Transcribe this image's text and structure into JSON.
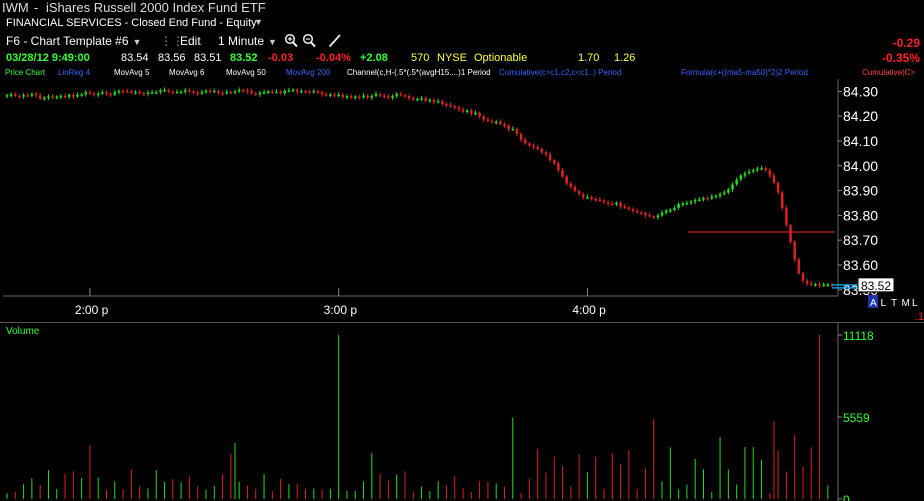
{
  "window": {
    "symbol": "IWM",
    "separator": "-",
    "description": "iShares Russell 2000 Index Fund ETF",
    "sector_line": "FINANCIAL SERVICES - Closed End Fund - Equity"
  },
  "toolbar": {
    "template_label": "F6 - Chart Template #6",
    "edit_label": "Edit",
    "interval_label": "1 Minute",
    "zoom_in_icon": "zoom-in-icon",
    "zoom_out_icon": "zoom-out-icon",
    "draw_icon": "pencil-icon"
  },
  "quote": {
    "datetime": "03/28/12 9:49:00",
    "open": "83.54",
    "high": "83.56",
    "low": "83.51",
    "close": "83.52",
    "change": "-0.03",
    "change_pct": "-0.04%",
    "tick": "+2.08",
    "volume": "570",
    "exchange": "NYSE",
    "optionable": "Optionable",
    "bid_size": "1.70",
    "ask_size": "1.26",
    "day_change": "-0.29",
    "day_change_pct": "-0.35%"
  },
  "studies": {
    "price_chart": "Price Chart",
    "linreg": "LinReg 4",
    "movavg1": "MovAvg 5",
    "movavg2": "MovAvg 6",
    "movavg50": "MovAvg 50",
    "movavg200": "MovAvg 200",
    "channel": "Channel(c,H-(.5*(.5*(avgH15....)1 Period",
    "cumulative1": "Cumulative(c>c1,c2,c<c1..) Period",
    "formula": "Formula(c+((ma5-ma50)*2)2 Period",
    "cumulative2": "Cumulative(C>"
  },
  "colors": {
    "up": "#22dd22",
    "down": "#dd2222",
    "axis_text": "#ffffff",
    "quote_green": "#33ff33",
    "quote_red": "#ff2020",
    "study_blue": "#3366ff",
    "hline": "#cc2222",
    "last_marker": "#00bbff"
  },
  "price_panel": {
    "y_ticks": [
      "84.30",
      "84.20",
      "84.10",
      "84.00",
      "83.90",
      "83.80",
      "83.70",
      "83.60",
      "83.50"
    ],
    "x_ticks": [
      "2:00 p",
      "3:00 p",
      "4:00 p"
    ],
    "last_price_label": "83.52",
    "axis_flags": [
      "A",
      "L",
      "T",
      "M",
      "L"
    ],
    "corner_label": ".1",
    "support_line": 83.733
  },
  "volume_panel": {
    "label": "Volume",
    "y_ticks": [
      "11118",
      "5559",
      "0"
    ]
  },
  "chart_data": {
    "type": "candlestick",
    "x": "1-minute bars, approx. 13:39 to 16:00",
    "y_axis_ticks": [
      84.3,
      84.2,
      84.1,
      84.0,
      83.9,
      83.8,
      83.7,
      83.6,
      83.5
    ],
    "ylim": [
      83.475,
      84.35
    ],
    "x_tick_labels": [
      "2:00 p",
      "3:00 p",
      "4:00 p"
    ],
    "close": [
      84.285,
      84.288,
      84.282,
      84.28,
      84.285,
      84.283,
      84.29,
      84.284,
      84.27,
      84.275,
      84.28,
      84.276,
      84.279,
      84.282,
      84.278,
      84.286,
      84.279,
      84.286,
      84.289,
      84.297,
      84.292,
      84.286,
      84.291,
      84.297,
      84.29,
      84.287,
      84.296,
      84.302,
      84.301,
      84.3,
      84.297,
      84.297,
      84.293,
      84.29,
      84.296,
      84.296,
      84.298,
      84.304,
      84.306,
      84.299,
      84.297,
      84.298,
      84.299,
      84.305,
      84.3,
      84.295,
      84.291,
      84.297,
      84.303,
      84.301,
      84.302,
      84.294,
      84.292,
      84.298,
      84.297,
      84.3,
      84.306,
      84.304,
      84.301,
      84.292,
      84.288,
      84.294,
      84.297,
      84.3,
      84.299,
      84.299,
      84.293,
      84.302,
      84.305,
      84.307,
      84.299,
      84.301,
      84.3,
      84.298,
      84.301,
      84.297,
      84.289,
      84.284,
      84.288,
      84.284,
      84.287,
      84.277,
      84.281,
      84.274,
      84.279,
      84.276,
      84.283,
      84.275,
      84.282,
      84.29,
      84.284,
      84.28,
      84.274,
      84.282,
      84.29,
      84.285,
      84.281,
      84.273,
      84.268,
      84.27,
      84.273,
      84.262,
      84.266,
      84.257,
      84.261,
      84.249,
      84.246,
      84.24,
      84.236,
      84.227,
      84.218,
      84.223,
      84.21,
      84.213,
      84.199,
      84.187,
      84.182,
      84.176,
      84.178,
      84.169,
      84.162,
      84.147,
      84.149,
      84.128,
      84.105,
      84.09,
      84.082,
      84.075,
      84.068,
      84.054,
      84.046,
      84.022,
      84.01,
      83.982,
      83.957,
      83.928,
      83.915,
      83.898,
      83.885,
      83.872,
      83.874,
      83.866,
      83.864,
      83.86,
      83.853,
      83.847,
      83.845,
      83.851,
      83.836,
      83.832,
      83.825,
      83.818,
      83.812,
      83.809,
      83.802,
      83.796,
      83.793,
      83.8,
      83.811,
      83.82,
      83.822,
      83.83,
      83.846,
      83.848,
      83.85,
      83.856,
      83.862,
      83.864,
      83.87,
      83.868,
      83.876,
      83.879,
      83.886,
      83.892,
      83.905,
      83.925,
      83.944,
      83.961,
      83.97,
      83.977,
      83.983,
      83.988,
      83.99,
      83.982,
      83.961,
      83.931,
      83.892,
      83.83,
      83.76,
      83.694,
      83.622,
      83.566,
      83.537,
      83.525,
      83.52,
      83.523,
      83.518,
      83.52,
      83.522,
      83.52
    ],
    "volume_ylim": [
      0,
      11118
    ],
    "volume_peak_values": [
      11118,
      11118,
      5559
    ],
    "support_line_value": 83.733,
    "last_price": 83.52
  }
}
